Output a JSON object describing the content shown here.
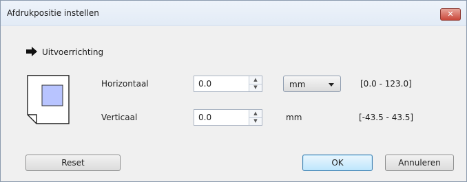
{
  "window": {
    "title": "Afdrukpositie instellen",
    "close_glyph": "✕"
  },
  "section": {
    "label": "Uitvoerrichting",
    "icon": "arrow-right-icon"
  },
  "horizontal": {
    "label": "Horizontaal",
    "value": "0.0",
    "unit_selected": "mm",
    "range": "[0.0 - 123.0]"
  },
  "vertical": {
    "label": "Verticaal",
    "value": "0.0",
    "unit": "mm",
    "range": "[-43.5 - 43.5]"
  },
  "buttons": {
    "reset": "Reset",
    "ok": "OK",
    "cancel": "Annuleren"
  },
  "colors": {
    "preview_fill": "#b8c4ff",
    "default_button_border": "#3c7fb1",
    "close_button": "#c9473a"
  }
}
